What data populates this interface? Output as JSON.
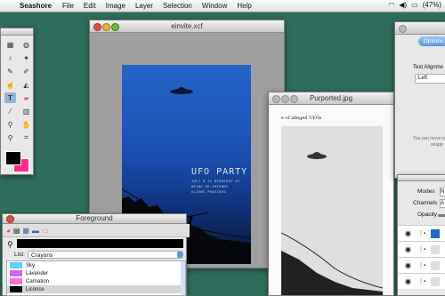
{
  "menubar": {
    "app": "Seashore",
    "items": [
      "File",
      "Edit",
      "Image",
      "Layer",
      "Selection",
      "Window",
      "Help"
    ],
    "battery": "(47%)"
  },
  "image_window": {
    "title": "einvite.xcf"
  },
  "poster": {
    "title": "UFO PARTY",
    "lines": [
      "JULY 8 12 MIDNIGHT AT",
      "BRING UR FRIENDS",
      "ALIENS PROVIDED"
    ]
  },
  "purported_window": {
    "title": "Purported.jpg",
    "caption": "e of alleged UFOs"
  },
  "foreground_window": {
    "title": "Foreground",
    "list_label": "List:",
    "list_value": "Crayons",
    "colors": [
      {
        "name": "Sky",
        "color": "#66ccff"
      },
      {
        "name": "Lavender",
        "color": "#cc66ff"
      },
      {
        "name": "Carnation",
        "color": "#ff6fcf"
      },
      {
        "name": "Licorice",
        "color": "#000000"
      }
    ],
    "selected": "Licorice"
  },
  "options_window": {
    "tab": "Options",
    "text_alignment_label": "Text Alignme",
    "alignment_value": "Left",
    "hint": "You can move a",
    "hint2": "snapp"
  },
  "layers_window": {
    "modes_label": "Modes",
    "modes_value": "N",
    "channels_label": "Channels",
    "channels_value": "A",
    "opacity_label": "Opacity"
  },
  "toolbox": {
    "fg_color": "#000000",
    "bg_color": "#ff2a8a",
    "tools": [
      "rect-select",
      "ellipse-select",
      "lasso",
      "wand",
      "pencil",
      "brush",
      "smudge",
      "bucket",
      "text",
      "eraser",
      "eyedropper",
      "gradient",
      "clone",
      "hand",
      "zoom",
      "crop"
    ]
  }
}
